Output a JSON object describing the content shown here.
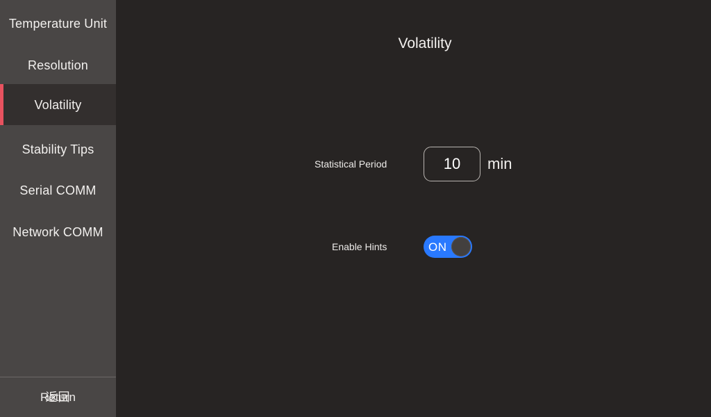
{
  "window": {
    "background_color": "#272423",
    "sidebar_color": "#494645"
  },
  "sidebar": {
    "accent_color": "#E8525F",
    "selected_background": "#332F2E",
    "items": [
      {
        "label": "Temperature Unit",
        "selected": false
      },
      {
        "label": "Resolution",
        "selected": false
      },
      {
        "label": "Volatility",
        "selected": true
      },
      {
        "label": "Stability Tips",
        "selected": false
      },
      {
        "label": "Serial COMM",
        "selected": false
      },
      {
        "label": "Network COMM",
        "selected": false
      }
    ],
    "footer": {
      "return_label": "Return",
      "return_label_overlay": "返回"
    }
  },
  "main": {
    "title": "Volatility",
    "settings": {
      "statistical_period": {
        "label": "Statistical Period",
        "value": "10",
        "placeholder": "10",
        "unit": "min"
      },
      "enable_hints": {
        "label": "Enable Hints",
        "state_label": "ON",
        "state_on": true,
        "on_color": "#2979FF",
        "knob_color": "#43403F"
      }
    }
  }
}
